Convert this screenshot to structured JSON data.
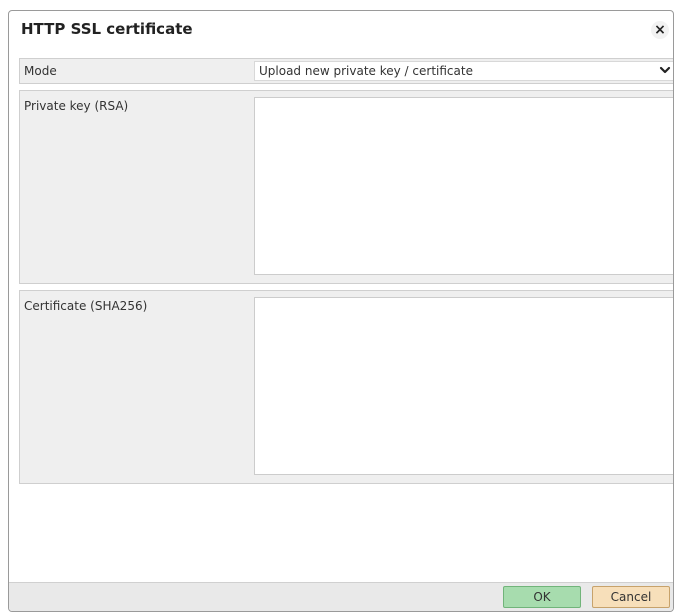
{
  "dialog": {
    "title": "HTTP SSL certificate",
    "close_glyph": "×"
  },
  "form": {
    "mode": {
      "label": "Mode",
      "selected": "Upload new private key / certificate"
    },
    "private_key": {
      "label": "Private key (RSA)",
      "value": ""
    },
    "certificate": {
      "label": "Certificate (SHA256)",
      "value": ""
    }
  },
  "buttons": {
    "ok": "OK",
    "cancel": "Cancel"
  },
  "colors": {
    "ok_button": "#a7dcae",
    "cancel_button": "#f7dfba",
    "row_background": "#efefef"
  },
  "icons": {
    "close": "close-icon",
    "dropdown": "chevron-down-icon"
  }
}
